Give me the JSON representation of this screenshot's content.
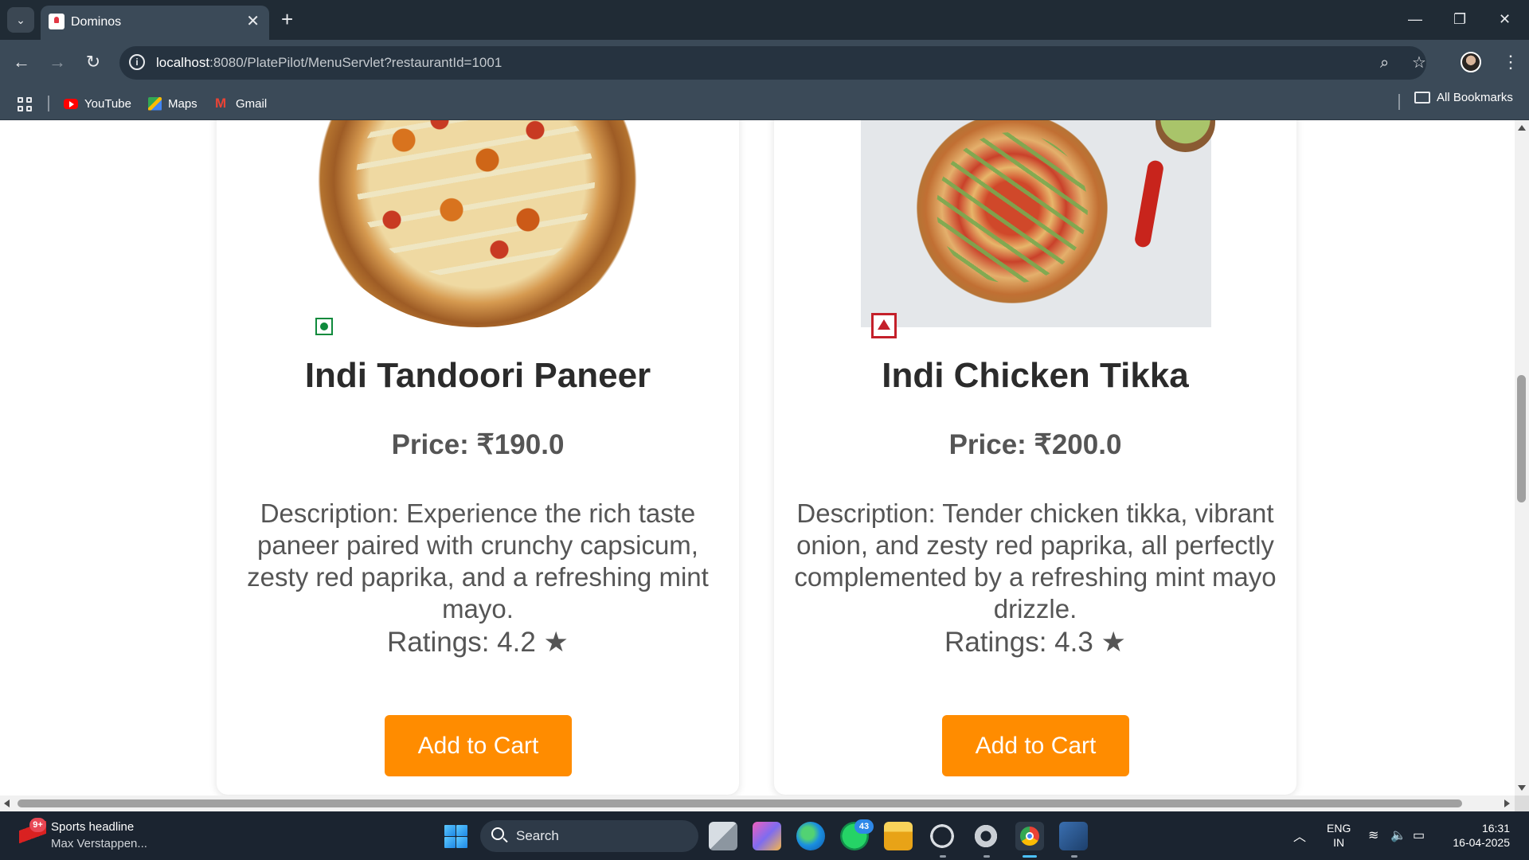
{
  "browser": {
    "tab_title": "Dominos",
    "tab_close": "✕",
    "new_tab": "+",
    "url_host": "localhost",
    "url_rest": ":8080/PlatePilot/MenuServlet?restaurantId=1001",
    "bookmarks": [
      {
        "label": "YouTube",
        "icon": "youtube-icon"
      },
      {
        "label": "Maps",
        "icon": "maps-icon"
      },
      {
        "label": "Gmail",
        "icon": "gmail-icon"
      }
    ],
    "all_bookmarks": "All Bookmarks"
  },
  "menu": {
    "items": [
      {
        "name": "Indi Tandoori Paneer",
        "price": "Price: ₹190.0",
        "description": "Description: Experience the rich taste paneer paired with crunchy capsicum, zesty red paprika, and a refreshing mint mayo.",
        "rating": "Ratings: 4.2 ★",
        "button": "Add to Cart",
        "diet": "veg"
      },
      {
        "name": "Indi Chicken Tikka",
        "price": "Price: ₹200.0",
        "description": "Description: Tender chicken tikka, vibrant onion, and zesty red paprika, all perfectly complemented by a refreshing mint mayo drizzle.",
        "rating": "Ratings: 4.3 ★",
        "button": "Add to Cart",
        "diet": "non-veg"
      }
    ],
    "accent_color": "#ff8c00"
  },
  "taskbar": {
    "news_badge": "9+",
    "news_title": "Sports headline",
    "news_sub": "Max Verstappen...",
    "search_label": "Search",
    "whatsapp_badge": "43",
    "lang_line1": "ENG",
    "lang_line2": "IN",
    "time": "16:31",
    "date": "16-04-2025"
  }
}
